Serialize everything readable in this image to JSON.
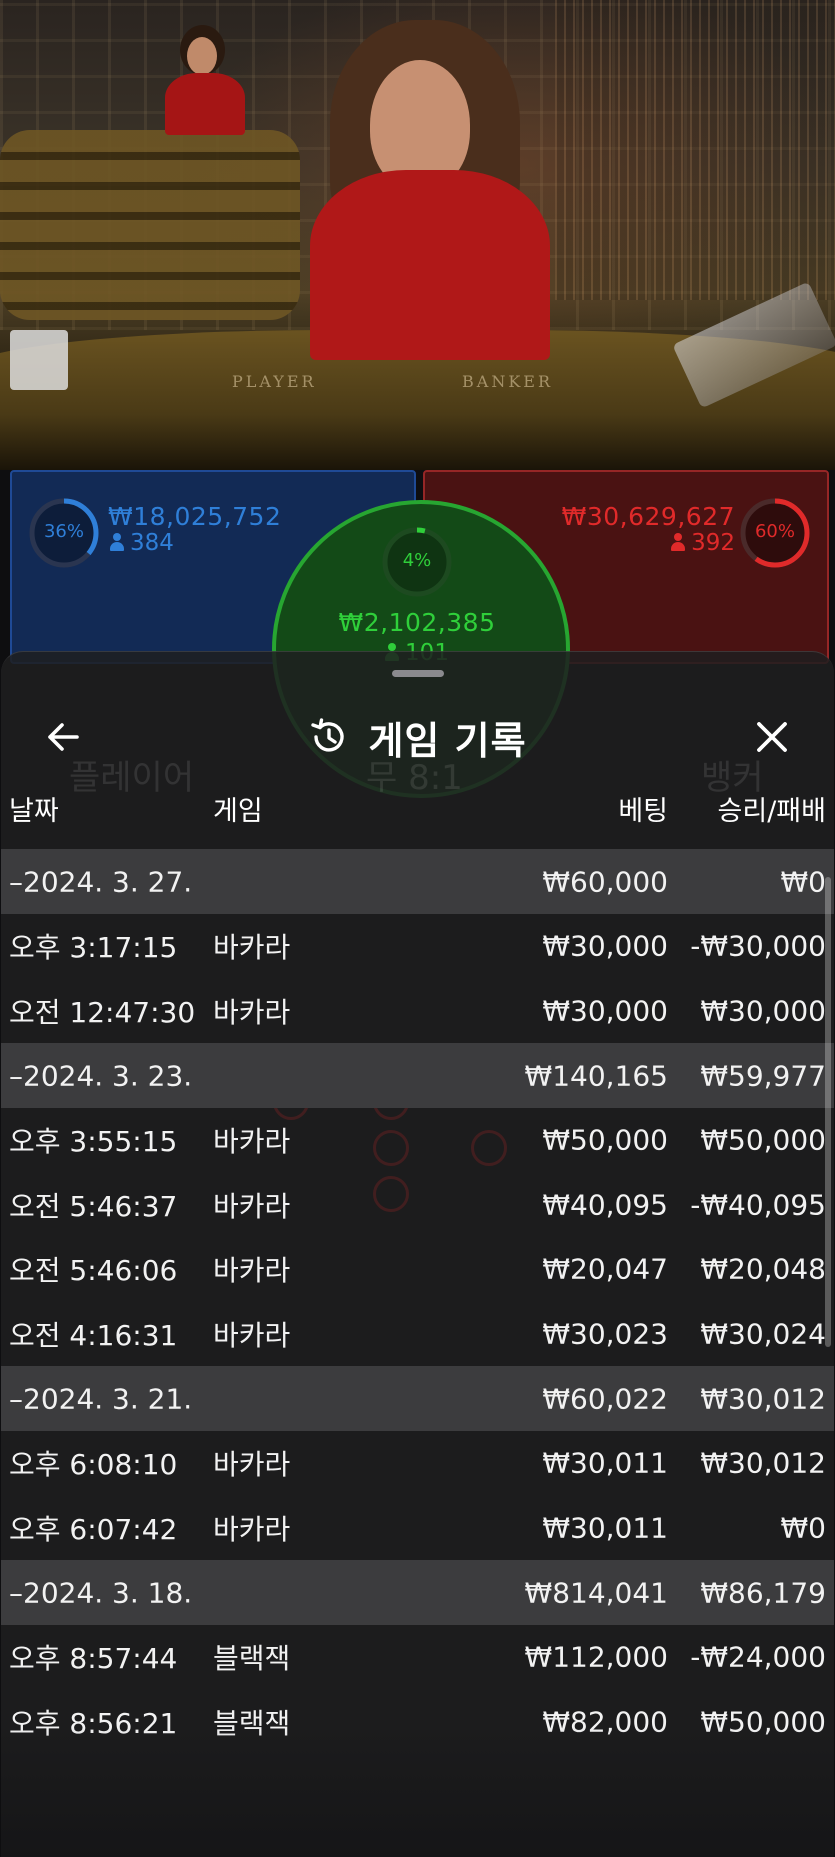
{
  "video": {
    "felt_labels": {
      "player": "PLAYER",
      "banker": "BANKER"
    }
  },
  "bet_panel": {
    "player": {
      "percent": "36%",
      "percent_value": 36,
      "amount": "₩18,025,752",
      "count": "384",
      "color": "#2f7fd8"
    },
    "tie": {
      "percent": "4%",
      "percent_value": 4,
      "amount": "₩2,102,385",
      "count": "101",
      "color": "#2fcf3a"
    },
    "banker": {
      "percent": "60%",
      "percent_value": 60,
      "amount": "₩30,629,627",
      "count": "392",
      "color": "#e02a2a"
    }
  },
  "background_ui": {
    "player_label": "플레이어",
    "tie_label": "무 8:1",
    "banker_label": "뱅커"
  },
  "history_sheet": {
    "back_icon": "arrow-left-icon",
    "history_icon": "history-clock-icon",
    "close_icon": "close-icon",
    "title": "게임 기록",
    "columns": {
      "date": "날짜",
      "game": "게임",
      "bet": "베팅",
      "win_loss": "승리/패배"
    },
    "groups": [
      {
        "date": "–2024. 3. 27.",
        "bet": "₩60,000",
        "win_loss": "₩0",
        "items": [
          {
            "time": "오후 3:17:15",
            "game": "바카라",
            "bet": "₩30,000",
            "win_loss": "-₩30,000"
          },
          {
            "time": "오전 12:47:30",
            "game": "바카라",
            "bet": "₩30,000",
            "win_loss": "₩30,000"
          }
        ]
      },
      {
        "date": "–2024. 3. 23.",
        "bet": "₩140,165",
        "win_loss": "₩59,977",
        "items": [
          {
            "time": "오후 3:55:15",
            "game": "바카라",
            "bet": "₩50,000",
            "win_loss": "₩50,000"
          },
          {
            "time": "오전 5:46:37",
            "game": "바카라",
            "bet": "₩40,095",
            "win_loss": "-₩40,095"
          },
          {
            "time": "오전 5:46:06",
            "game": "바카라",
            "bet": "₩20,047",
            "win_loss": "₩20,048"
          },
          {
            "time": "오전 4:16:31",
            "game": "바카라",
            "bet": "₩30,023",
            "win_loss": "₩30,024"
          }
        ]
      },
      {
        "date": "–2024. 3. 21.",
        "bet": "₩60,022",
        "win_loss": "₩30,012",
        "items": [
          {
            "time": "오후 6:08:10",
            "game": "바카라",
            "bet": "₩30,011",
            "win_loss": "₩30,012"
          },
          {
            "time": "오후 6:07:42",
            "game": "바카라",
            "bet": "₩30,011",
            "win_loss": "₩0"
          }
        ]
      },
      {
        "date": "–2024. 3. 18.",
        "bet": "₩814,041",
        "win_loss": "₩86,179",
        "items": [
          {
            "time": "오후 8:57:44",
            "game": "블랙잭",
            "bet": "₩112,000",
            "win_loss": "-₩24,000"
          },
          {
            "time": "오후 8:56:21",
            "game": "블랙잭",
            "bet": "₩82,000",
            "win_loss": "₩50,000"
          }
        ]
      }
    ]
  }
}
